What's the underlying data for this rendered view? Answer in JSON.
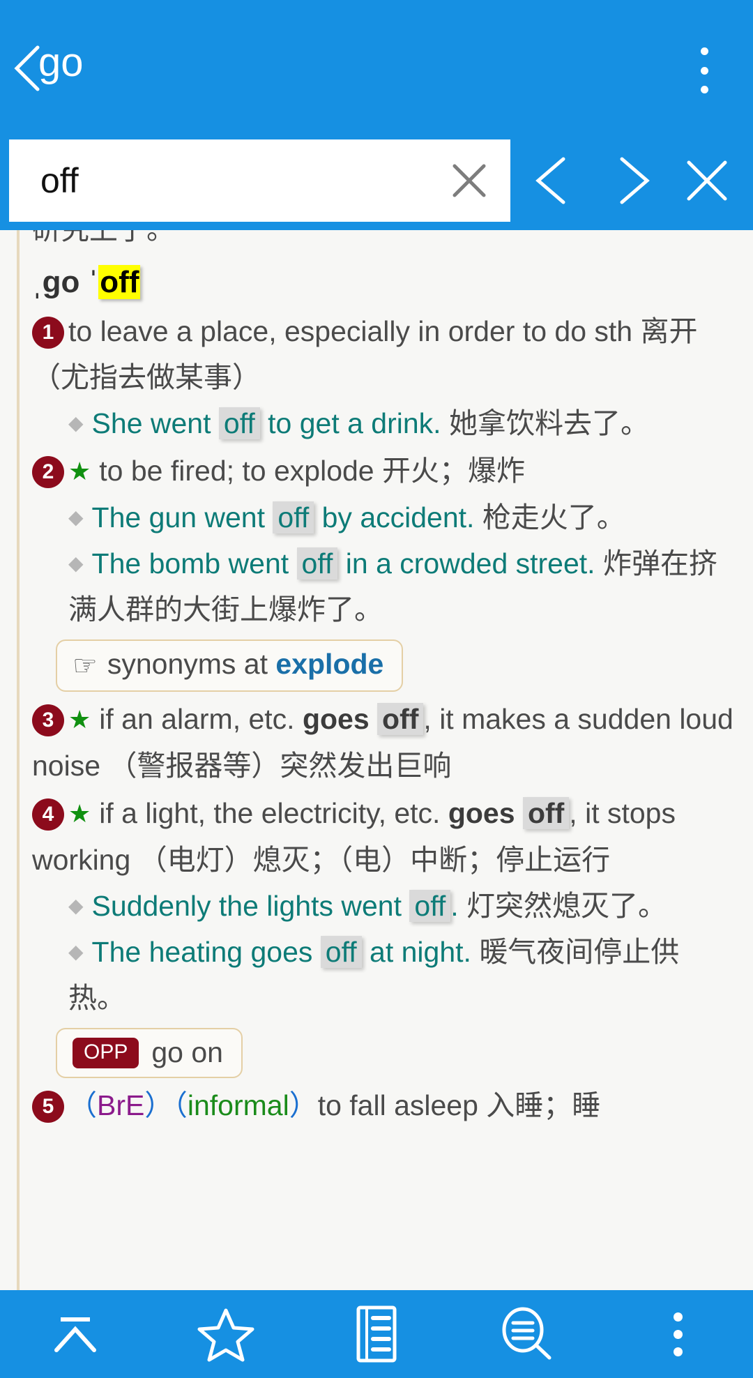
{
  "appbar": {
    "back_icon": "chevron-left-icon",
    "title": "go",
    "overflow_icon": "more-vertical-icon"
  },
  "search": {
    "value": "off",
    "placeholder": "",
    "clear_icon": "close-icon",
    "prev_icon": "chevron-left-icon",
    "next_icon": "chevron-right-icon",
    "close_icon": "close-icon"
  },
  "entry": {
    "partial_top_line": "研究上了。",
    "headword_pre": "ˌgo ˈ",
    "headword_hl": "off",
    "senses": [
      {
        "num": "1",
        "star": false,
        "def_en_a": "to leave a place, especially in order to do sth ",
        "def_cn": "离开（尤指去做某事）",
        "examples": [
          {
            "en_a": "She went ",
            "hl": "off",
            "en_b": " to get a drink. ",
            "cn": "她拿饮料去了。"
          }
        ]
      },
      {
        "num": "2",
        "star": true,
        "def_en_a": "to be fired; to explode ",
        "def_cn": "开火；爆炸",
        "examples": [
          {
            "en_a": "The gun went ",
            "hl": "off",
            "en_b": " by accident. ",
            "cn": "枪走火了。"
          },
          {
            "en_a": "The bomb went ",
            "hl": "off",
            "en_b": " in a crowded street. ",
            "cn": "炸弹在挤满人群的大街上爆炸了。"
          }
        ],
        "xref": {
          "type": "synonyms",
          "icon": "pointing-hand-icon",
          "text": "synonyms at ",
          "link": "explode"
        }
      },
      {
        "num": "3",
        "star": true,
        "def_pre": "if an alarm, etc. ",
        "def_bold": "goes ",
        "def_hl": "off",
        "def_post": ", it makes a sudden loud noise ",
        "def_cn": "（警报器等）突然发出巨响"
      },
      {
        "num": "4",
        "star": true,
        "def_pre": "if a light, the electricity, etc. ",
        "def_bold": "goes ",
        "def_hl": "off",
        "def_post": ", it stops working ",
        "def_cn": "（电灯）熄灭；（电）中断；停止运行",
        "examples": [
          {
            "en_a": "Suddenly the lights went ",
            "hl": "off",
            "en_b": ". ",
            "cn": "灯突然熄灭了。"
          },
          {
            "en_a": "The heating goes ",
            "hl": "off",
            "en_b": " at night. ",
            "cn": "暖气夜间停止供热。"
          }
        ],
        "xref": {
          "type": "opp",
          "badge": "OPP",
          "link": "go on"
        }
      },
      {
        "num": "5",
        "star": false,
        "label_bre": "BrE",
        "label_informal": "informal",
        "def_en_a": "to fall asleep ",
        "def_cn": "入睡；睡"
      }
    ]
  },
  "bottombar": {
    "items": [
      {
        "icon": "scroll-to-top-icon",
        "label": ""
      },
      {
        "icon": "star-outline-icon",
        "label": ""
      },
      {
        "icon": "list-document-icon",
        "label": ""
      },
      {
        "icon": "search-in-page-icon",
        "label": ""
      },
      {
        "icon": "more-vertical-icon",
        "label": ""
      }
    ]
  },
  "colors": {
    "accent": "#1690e2",
    "highlight_current": "#ffff00",
    "highlight_other": "#dadada",
    "example_text": "#0d7b77",
    "sense_number": "#8c0b1c",
    "star": "#109010",
    "xref_link": "#1a6fa8",
    "label_bre": "#8b1a8b",
    "label_informal": "#1a8b1a"
  }
}
